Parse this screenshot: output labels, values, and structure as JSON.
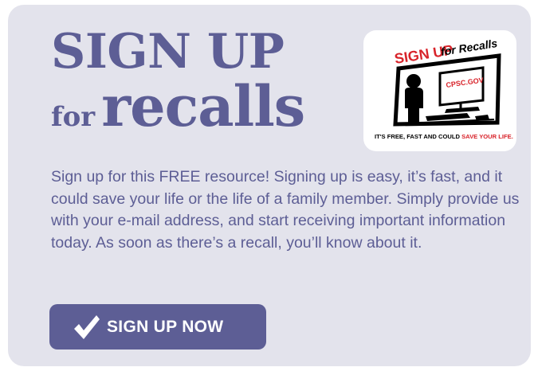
{
  "colors": {
    "card_background": "#e3e3ec",
    "accent": "#5d5e95",
    "logo_red": "#d8232a",
    "white": "#ffffff"
  },
  "headline": {
    "line1": "SIGN UP",
    "for": "for",
    "recalls": "recalls"
  },
  "logo": {
    "icon": "sign-up-for-recalls-logo",
    "sign_up": "SIGN UP",
    "for_recalls": "for Recalls",
    "screen_text": "CPSC.GOV",
    "tagline_part1": "IT'S FREE, FAST AND COULD ",
    "tagline_part2": "SAVE YOUR LIFE."
  },
  "body": {
    "text": "Sign up for this FREE resource! Signing up is easy, it’s fast, and it could save your life or the life of a family member. Simply provide us with your e-mail address, and start receiving important information today. As soon as there’s a recall, you’ll know about it."
  },
  "cta": {
    "icon": "checkmark-icon",
    "label": "SIGN UP NOW"
  }
}
